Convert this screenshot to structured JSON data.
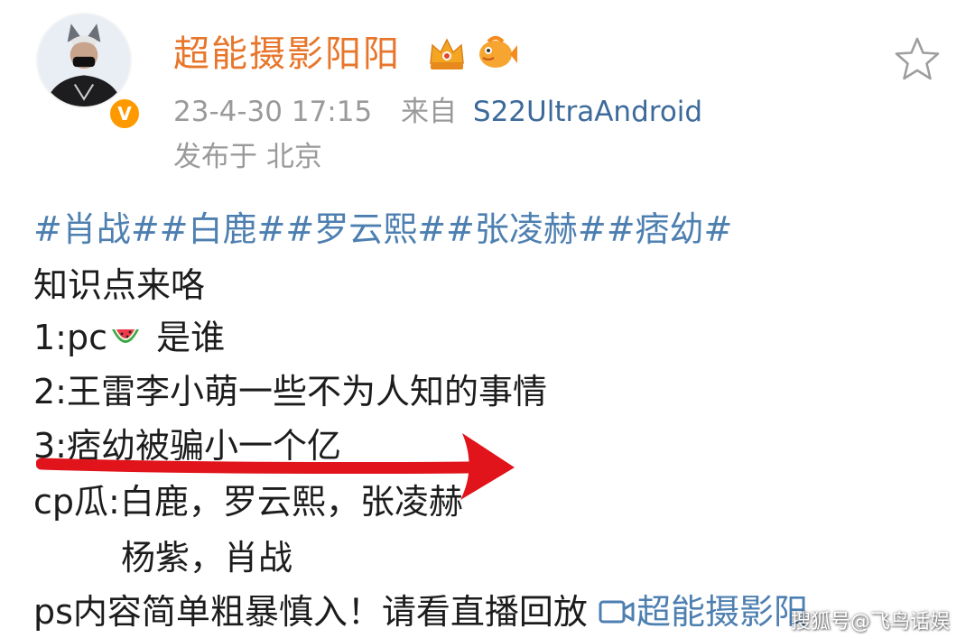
{
  "post": {
    "author": {
      "name": "超能摄影阳阳",
      "verified_badge": "V"
    },
    "meta": {
      "timestamp": "23-4-30 17:15",
      "source_prefix": "来自",
      "source": "S22UltraAndroid",
      "location": "发布于 北京"
    },
    "content": {
      "hashtags": "#肖战##白鹿##罗云熙##张凌赫##痞幼#",
      "line1": "知识点来咯",
      "line2_prefix": "1:pc",
      "line2_suffix": " 是谁",
      "line3": "2:王雷李小萌一些不为人知的事情",
      "line4": "3:痞幼被骗小一个亿",
      "line5": "cp瓜:白鹿，罗云熙，张凌赫",
      "line6": "杨紫，肖战",
      "line7_text": "ps内容简单粗暴慎入！请看直播回放 ",
      "replay_link": "超能摄影阳"
    }
  },
  "watermark": "搜狐号@飞鸟话娱",
  "icons": {
    "favorite": "star-outline-icon",
    "crown": "crown-icon",
    "fish": "fish-icon",
    "watermelon": "watermelon-emoji-icon",
    "replay": "video-replay-icon"
  },
  "colors": {
    "username": "#e7762b",
    "hashtag": "#4d7fb0",
    "meta": "#9a9a9a",
    "annotation_arrow": "#e0141a"
  }
}
